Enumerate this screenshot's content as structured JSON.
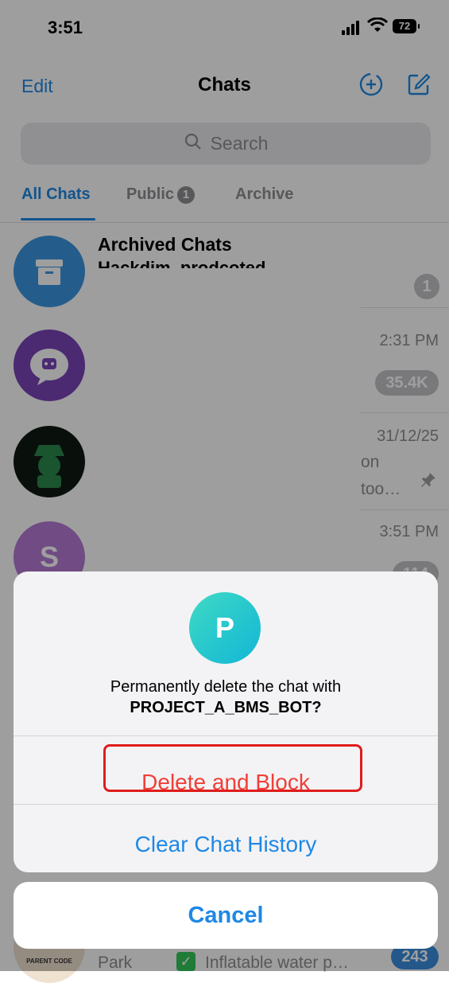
{
  "status_bar": {
    "time": "3:51",
    "battery": "72"
  },
  "nav": {
    "edit": "Edit",
    "title": "Chats"
  },
  "search": {
    "placeholder": "Search"
  },
  "tabs": [
    {
      "label": "All Chats",
      "active": true
    },
    {
      "label": "Public",
      "badge": "1"
    },
    {
      "label": "Archive"
    }
  ],
  "chats": [
    {
      "title": "Archived Chats",
      "subtitle": "Hackdim, prodcoted…",
      "badge": "1"
    },
    {
      "time": "2:31 PM",
      "badge": "35.4K"
    },
    {
      "time": "31/12/25",
      "snippet_1": "on",
      "snippet_2": "too…",
      "pinned": true
    },
    {
      "avatar_letter": "S",
      "time": "3:51 PM",
      "badge": "114"
    },
    {
      "row_badge": "243",
      "snippet": "Park",
      "snippet_2": "Inflatable water p…",
      "avatar_caption": "PARENT CODE"
    }
  ],
  "dialog": {
    "avatar_letter": "P",
    "message_line1": "Permanently delete the chat with",
    "message_line2": "PROJECT_A_BMS_BOT?",
    "delete_label": "Delete and Block",
    "clear_label": "Clear Chat History",
    "cancel_label": "Cancel"
  },
  "colors": {
    "accent": "#1e88e5",
    "danger": "#f04038",
    "highlight": "#e01c1c"
  }
}
